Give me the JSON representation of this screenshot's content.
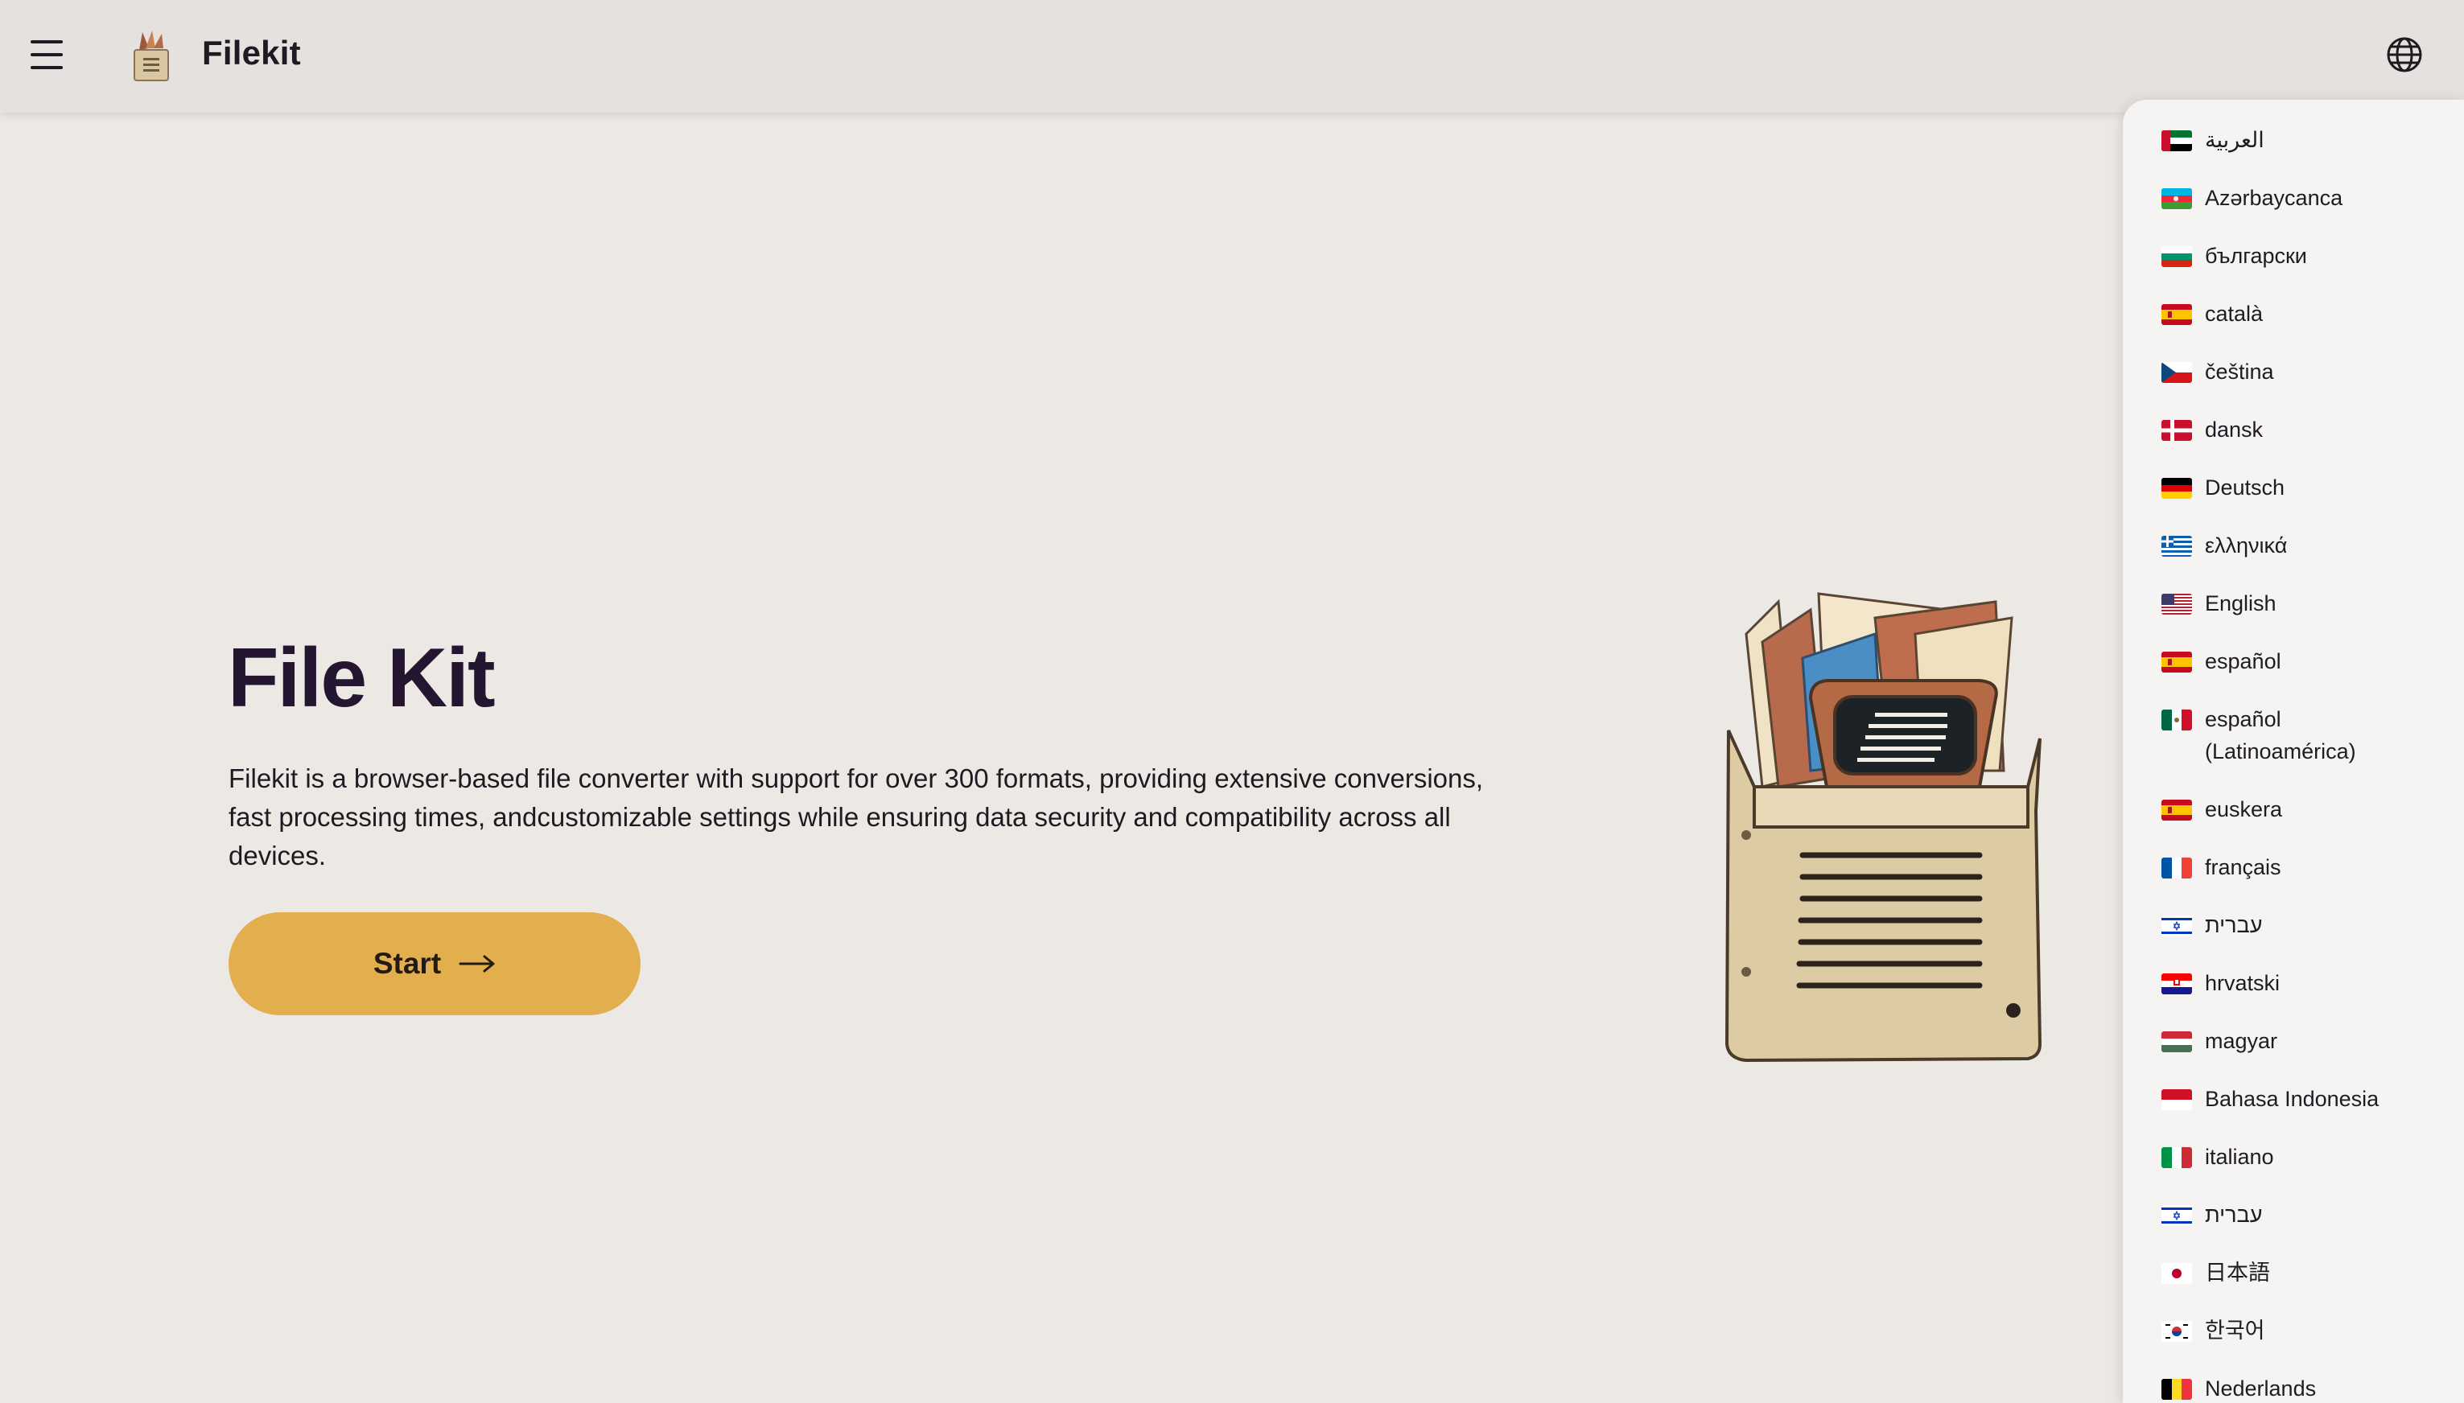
{
  "header": {
    "brand": "Filekit",
    "menu_icon": "hamburger-menu-icon",
    "logo": "filekit-logo",
    "language_icon": "globe-icon"
  },
  "hero": {
    "title": "File Kit",
    "description": "Filekit is a browser-based file converter with support for over 300 formats, providing extensive conversions, fast processing times, andcustomizable settings while ensuring data security and compatibility across all devices.",
    "start_label": "Start",
    "start_icon": "arrow-right-icon",
    "illustration": "file-box-illustration"
  },
  "colors": {
    "background": "#ece9e5",
    "header": "#e4e1de",
    "accent": "#e3ae4d",
    "title": "#241530",
    "menu": "#f5f4f2"
  },
  "languages": [
    {
      "label": "العربية",
      "flag": "ae"
    },
    {
      "label": "Azərbaycanca",
      "flag": "az"
    },
    {
      "label": "български",
      "flag": "bg"
    },
    {
      "label": "català",
      "flag": "es"
    },
    {
      "label": "čeština",
      "flag": "cz"
    },
    {
      "label": "dansk",
      "flag": "dk"
    },
    {
      "label": "Deutsch",
      "flag": "de"
    },
    {
      "label": "ελληνικά",
      "flag": "gr"
    },
    {
      "label": "English",
      "flag": "us"
    },
    {
      "label": "español",
      "flag": "es"
    },
    {
      "label": "español (Latinoamérica)",
      "flag": "mx"
    },
    {
      "label": "euskera",
      "flag": "es"
    },
    {
      "label": "français",
      "flag": "fr"
    },
    {
      "label": "עברית",
      "flag": "il"
    },
    {
      "label": "hrvatski",
      "flag": "hr"
    },
    {
      "label": "magyar",
      "flag": "hu"
    },
    {
      "label": "Bahasa Indonesia",
      "flag": "id"
    },
    {
      "label": "italiano",
      "flag": "it"
    },
    {
      "label": "עברית",
      "flag": "il"
    },
    {
      "label": "日本語",
      "flag": "jp"
    },
    {
      "label": "한국어",
      "flag": "kr"
    },
    {
      "label": "Nederlands",
      "flag": "be"
    }
  ]
}
